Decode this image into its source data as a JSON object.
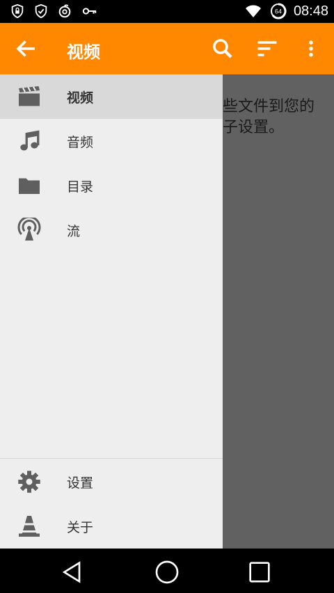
{
  "status_bar": {
    "time": "08:48",
    "battery_level": "64",
    "icons": [
      "shield-lock-icon",
      "shield-check-icon",
      "netease-music-icon",
      "key-icon",
      "wifi-icon",
      "battery-icon"
    ]
  },
  "app_bar": {
    "title": "视频",
    "icons": [
      "back-arrow-icon",
      "search-icon",
      "sort-icon",
      "more-vert-icon"
    ]
  },
  "content": {
    "message_line1": "些文件到您的",
    "message_line2": "子设置。"
  },
  "drawer": {
    "items": [
      {
        "label": "视频",
        "icon": "clapperboard-icon",
        "selected": true
      },
      {
        "label": "音频",
        "icon": "music-note-icon",
        "selected": false
      },
      {
        "label": "目录",
        "icon": "folder-icon",
        "selected": false
      },
      {
        "label": "流",
        "icon": "stream-antenna-icon",
        "selected": false
      }
    ],
    "footer_items": [
      {
        "label": "设置",
        "icon": "gear-icon"
      },
      {
        "label": "关于",
        "icon": "vlc-cone-icon"
      }
    ]
  },
  "colors": {
    "accent": "#ff8800",
    "drawer_bg": "#eeeeee",
    "selected_bg": "#d9d9d9",
    "icon_gray": "#5f5f5f"
  },
  "nav_bar": {
    "icons": [
      "nav-back-icon",
      "nav-home-icon",
      "nav-recents-icon"
    ]
  }
}
